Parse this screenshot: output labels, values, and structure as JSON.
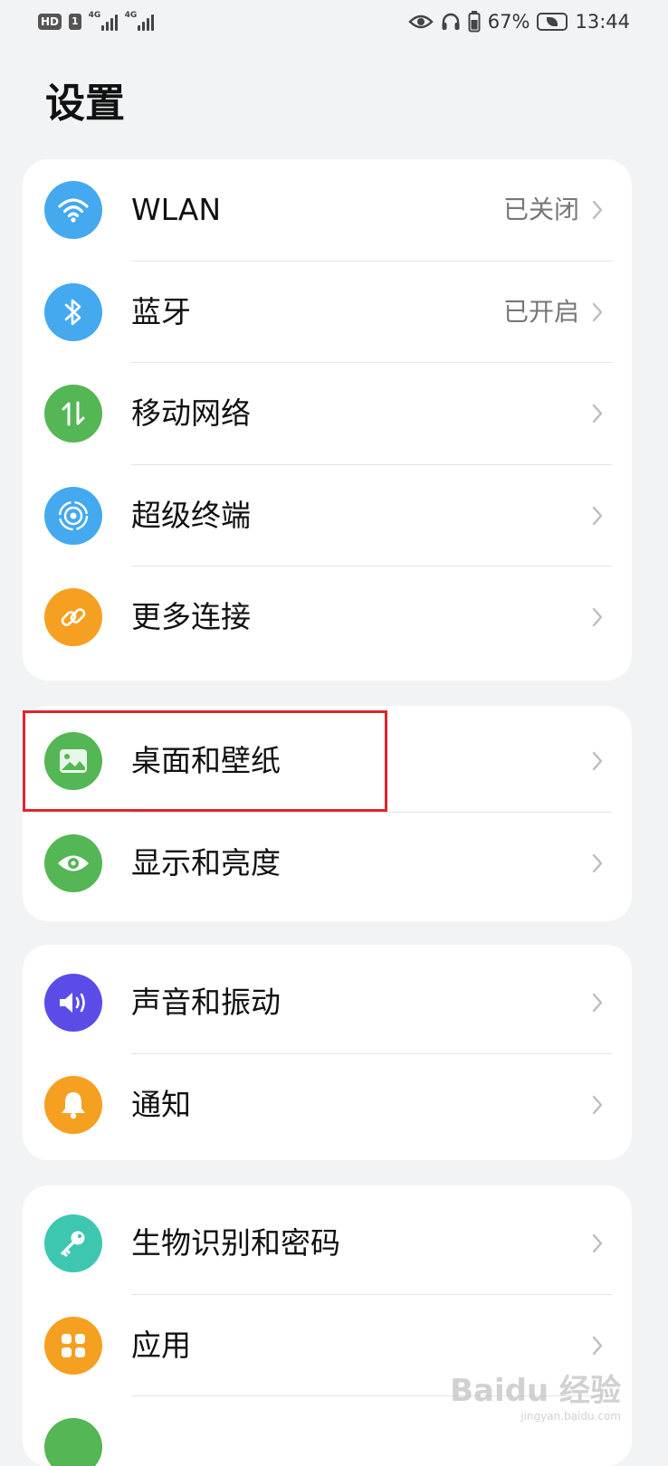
{
  "status_bar": {
    "hd": "HD",
    "sim": "1",
    "net1": "4G",
    "net2": "4G",
    "battery": "67%",
    "time": "13:44"
  },
  "title": "设置",
  "groups": [
    {
      "items": [
        {
          "label": "WLAN",
          "value": "已关闭",
          "icon": "wifi-icon",
          "color": "#44a9ee"
        },
        {
          "label": "蓝牙",
          "value": "已开启",
          "icon": "bluetooth-icon",
          "color": "#44a9ee"
        },
        {
          "label": "移动网络",
          "value": "",
          "icon": "mobile-data-icon",
          "color": "#54b654"
        },
        {
          "label": "超级终端",
          "value": "",
          "icon": "super-device-icon",
          "color": "#44a9ee"
        },
        {
          "label": "更多连接",
          "value": "",
          "icon": "link-icon",
          "color": "#f5a021"
        }
      ]
    },
    {
      "items": [
        {
          "label": "桌面和壁纸",
          "value": "",
          "icon": "wallpaper-icon",
          "color": "#54b654"
        },
        {
          "label": "显示和亮度",
          "value": "",
          "icon": "eye-icon",
          "color": "#54b654"
        }
      ]
    },
    {
      "items": [
        {
          "label": "声音和振动",
          "value": "",
          "icon": "speaker-icon",
          "color": "#5b4ce8"
        },
        {
          "label": "通知",
          "value": "",
          "icon": "bell-icon",
          "color": "#f5a021"
        }
      ]
    },
    {
      "items": [
        {
          "label": "生物识别和密码",
          "value": "",
          "icon": "key-icon",
          "color": "#3ec7b0"
        },
        {
          "label": "应用",
          "value": "",
          "icon": "apps-icon",
          "color": "#f5a021"
        }
      ]
    }
  ],
  "highlight_color": "#e0242c",
  "watermark": {
    "brand": "Baidu 经验",
    "url": "jingyan.baidu.com"
  }
}
